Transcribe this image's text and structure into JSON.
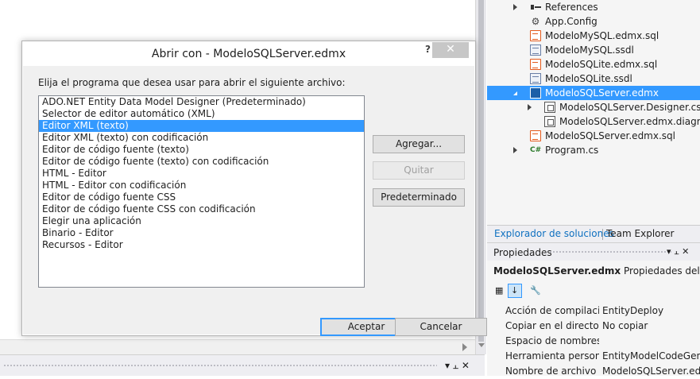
{
  "dialog": {
    "title": "Abrir con - ModeloSQLServer.edmx",
    "help": "?",
    "close": "✕",
    "prompt": "Elija el programa que desea usar para abrir el siguiente archivo:",
    "programs": [
      "ADO.NET Entity Data Model Designer (Predeterminado)",
      "Selector de editor automático (XML)",
      "Editor XML (texto)",
      "Editor XML (texto) con codificación",
      "Editor de código fuente (texto)",
      "Editor de código fuente (texto) con codificación",
      "HTML - Editor",
      "HTML - Editor con codificación",
      "Editor de código fuente CSS",
      "Editor de código fuente CSS con codificación",
      "Elegir una aplicación",
      "Binario - Editor",
      "Recursos - Editor"
    ],
    "selected_program": "Editor XML (texto)",
    "buttons": {
      "add": "Agregar...",
      "remove": "Quitar",
      "set_default": "Predeterminado",
      "ok": "Aceptar",
      "cancel": "Cancelar"
    }
  },
  "solution_explorer": {
    "items": [
      {
        "label": "References",
        "icon": "references-icon",
        "indent": 0,
        "expander": "collapsed"
      },
      {
        "label": "App.Config",
        "icon": "config-icon",
        "indent": 0,
        "expander": "none"
      },
      {
        "label": "ModeloMySQL.edmx.sql",
        "icon": "sql-file-icon",
        "indent": 0,
        "expander": "none"
      },
      {
        "label": "ModeloMySQL.ssdl",
        "icon": "ssdl-file-icon",
        "indent": 0,
        "expander": "none"
      },
      {
        "label": "ModeloSQLite.edmx.sql",
        "icon": "sql-file-icon",
        "indent": 0,
        "expander": "none"
      },
      {
        "label": "ModeloSQLite.ssdl",
        "icon": "ssdl-file-icon",
        "indent": 0,
        "expander": "none"
      },
      {
        "label": "ModeloSQLServer.edmx",
        "icon": "edmx-file-icon",
        "indent": 0,
        "expander": "expanded",
        "selected": true
      },
      {
        "label": "ModeloSQLServer.Designer.cs",
        "icon": "cs-file-icon",
        "indent": 1,
        "expander": "collapsed"
      },
      {
        "label": "ModeloSQLServer.edmx.diagram",
        "icon": "diagram-file-icon",
        "indent": 1,
        "expander": "none"
      },
      {
        "label": "ModeloSQLServer.edmx.sql",
        "icon": "sql-file-icon",
        "indent": 0,
        "expander": "none"
      },
      {
        "label": "Program.cs",
        "icon": "csharp-file-icon",
        "indent": 0,
        "expander": "collapsed"
      }
    ],
    "tabs": {
      "solution": "Explorador de soluciones",
      "team": "Team Explorer"
    }
  },
  "properties": {
    "title": "Propiedades",
    "pin": "▾ ⫠ ✕",
    "object_name": "ModeloSQLServer.edmx",
    "object_type": "Propiedades del archi",
    "rows": [
      {
        "name": "Acción de compilación",
        "value": "EntityDeploy"
      },
      {
        "name": "Copiar en el directorio",
        "value": "No copiar"
      },
      {
        "name": "Espacio de nombres d",
        "value": ""
      },
      {
        "name": "Herramienta personali",
        "value": "EntityModelCodeGener"
      },
      {
        "name": "Nombre de archivo",
        "value": "ModeloSQLServer.edmx"
      }
    ]
  },
  "bottom_bar": {
    "controls": "▾ ⫠ ✕"
  },
  "colors": {
    "selection": "#3399ff",
    "dialog_body": "#f0f0f0",
    "link_tab": "#0e70c0"
  }
}
